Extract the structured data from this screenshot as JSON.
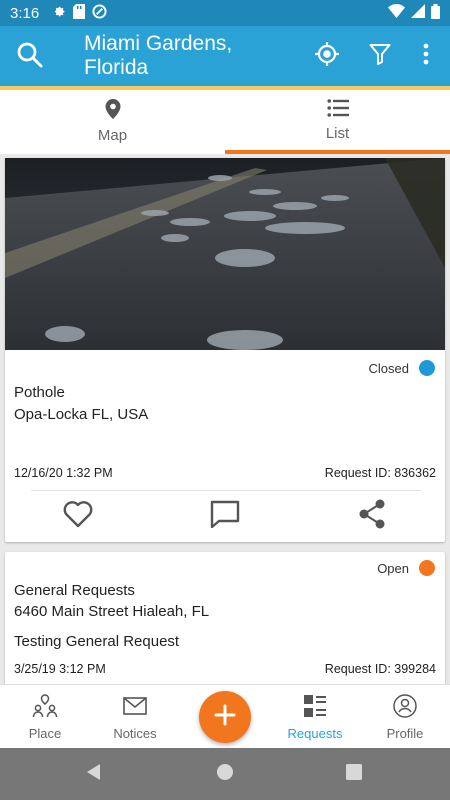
{
  "status_bar": {
    "time": "3:16",
    "icons": [
      "gear-icon",
      "sd-card-icon",
      "do-not-disturb-icon",
      "wifi-icon",
      "cell-signal-icon",
      "battery-icon"
    ]
  },
  "app_bar": {
    "location": "Miami Gardens, Florida",
    "icons": [
      "search-icon",
      "my-location-icon",
      "filter-icon",
      "more-vert-icon"
    ]
  },
  "tabs": [
    {
      "label": "Map",
      "icon": "map-pin-icon",
      "active": false
    },
    {
      "label": "List",
      "icon": "list-icon",
      "active": true
    }
  ],
  "requests": [
    {
      "status": "Closed",
      "status_color": "#1d9ad6",
      "has_image": true,
      "image_subject": "pothole-road-photo",
      "category": "Pothole",
      "address": "Opa-Locka FL, USA",
      "description": "",
      "datetime": "12/16/20 1:32 PM",
      "request_id": "Request ID: 836362",
      "actions": [
        "heart-icon",
        "comment-icon",
        "share-icon"
      ]
    },
    {
      "status": "Open",
      "status_color": "#f1761e",
      "has_image": false,
      "category": "General Requests",
      "address": "6460 Main Street Hialeah, FL",
      "description": "Testing General Request",
      "datetime": "3/25/19 3:12 PM",
      "request_id": "Request ID: 399284"
    }
  ],
  "bottom_nav": {
    "items": [
      {
        "label": "Place",
        "icon": "place-people-icon",
        "active": false
      },
      {
        "label": "Notices",
        "icon": "envelope-icon",
        "active": false
      },
      {
        "label": "Requests",
        "icon": "requests-list-icon",
        "active": true
      },
      {
        "label": "Profile",
        "icon": "profile-icon",
        "active": false
      }
    ],
    "fab_icon": "plus-icon"
  },
  "system_nav": [
    "back-icon",
    "home-icon",
    "recents-icon"
  ],
  "colors": {
    "primary": "#2aa2d6",
    "status_bar": "#1f88b9",
    "accent": "#f1761e",
    "app_bar_underline": "#f7c95a"
  }
}
